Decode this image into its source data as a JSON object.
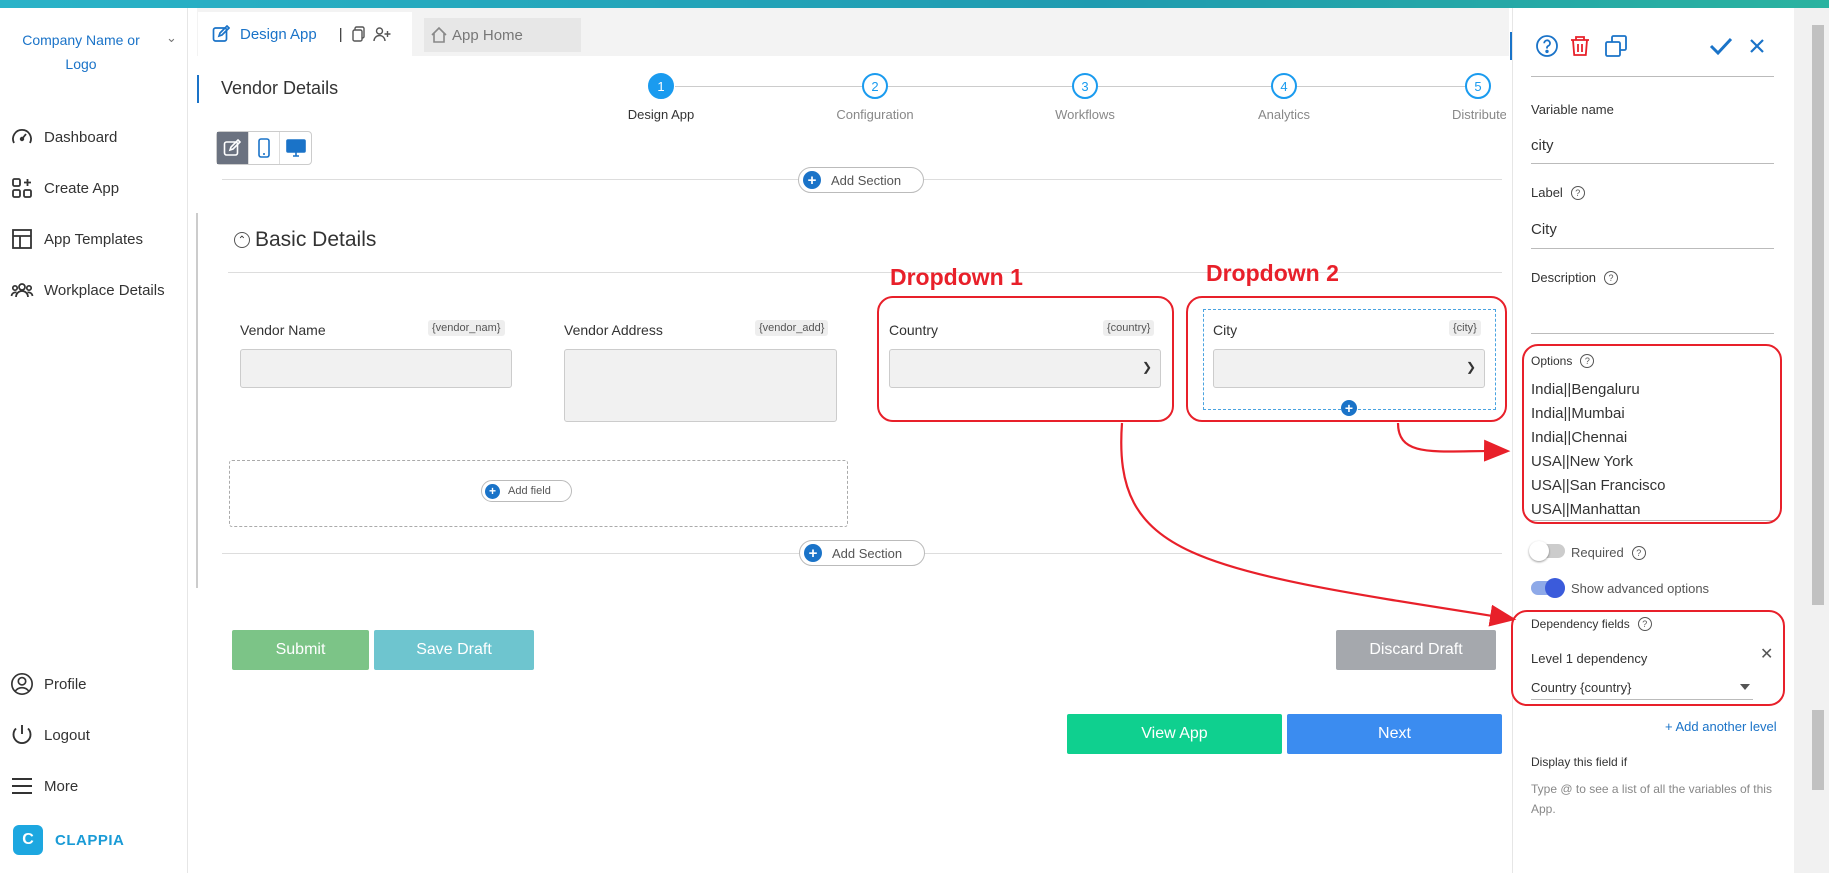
{
  "sidebar": {
    "company": "Company Name or Logo",
    "items": [
      {
        "label": "Dashboard",
        "icon": "gauge-icon"
      },
      {
        "label": "Create App",
        "icon": "apps-plus-icon"
      },
      {
        "label": "App Templates",
        "icon": "template-icon"
      },
      {
        "label": "Workplace Details",
        "icon": "users-icon"
      }
    ],
    "bottom_items": [
      {
        "label": "Profile",
        "icon": "user-icon"
      },
      {
        "label": "Logout",
        "icon": "power-icon"
      },
      {
        "label": "More",
        "icon": "menu-icon"
      }
    ],
    "brand": "CLAPPIA",
    "brand_letter": "C"
  },
  "tabs": {
    "design": "Design App",
    "home": "App Home",
    "separator": "|"
  },
  "page": {
    "title": "Vendor Details"
  },
  "steps": [
    {
      "num": "1",
      "label": "Design App",
      "active": true
    },
    {
      "num": "2",
      "label": "Configuration",
      "active": false
    },
    {
      "num": "3",
      "label": "Workflows",
      "active": false
    },
    {
      "num": "4",
      "label": "Analytics",
      "active": false
    },
    {
      "num": "5",
      "label": "Distribute",
      "active": false
    }
  ],
  "canvas": {
    "add_section": "Add Section",
    "section_title": "Basic Details",
    "add_field": "Add field",
    "fields": [
      {
        "label": "Vendor Name",
        "tag": "{vendor_nam}"
      },
      {
        "label": "Vendor Address",
        "tag": "{vendor_add}"
      },
      {
        "label": "Country",
        "tag": "{country}"
      },
      {
        "label": "City",
        "tag": "{city}"
      }
    ]
  },
  "buttons": {
    "submit": "Submit",
    "save_draft": "Save Draft",
    "discard_draft": "Discard Draft",
    "view_app": "View App",
    "next": "Next"
  },
  "annotations": {
    "dropdown1": "Dropdown 1",
    "dropdown2": "Dropdown 2"
  },
  "panel": {
    "variable_name_label": "Variable name",
    "variable_name": "city",
    "label_label": "Label",
    "label_value": "City",
    "description_label": "Description",
    "options_label": "Options",
    "options": [
      "India||Bengaluru",
      "India||Mumbai",
      "India||Chennai",
      "USA||New York",
      "USA||San Francisco",
      "USA||Manhattan"
    ],
    "required_label": "Required",
    "advanced_label": "Show advanced options",
    "dependency_label": "Dependency fields",
    "level1_label": "Level 1 dependency",
    "level1_value": "Country {country}",
    "add_level": "+ Add another level",
    "display_if_label": "Display this field if",
    "display_if_hint": "Type @ to see a list of all the variables of this App."
  },
  "colors": {
    "accent": "#1a73c8",
    "step": "#1a9bef",
    "submit": "#7cc487",
    "save_draft": "#6ec5cf",
    "discard": "#a5a8ad",
    "view_app": "#0fd08f",
    "next": "#3b8cf0",
    "annotation": "#e8202a"
  }
}
